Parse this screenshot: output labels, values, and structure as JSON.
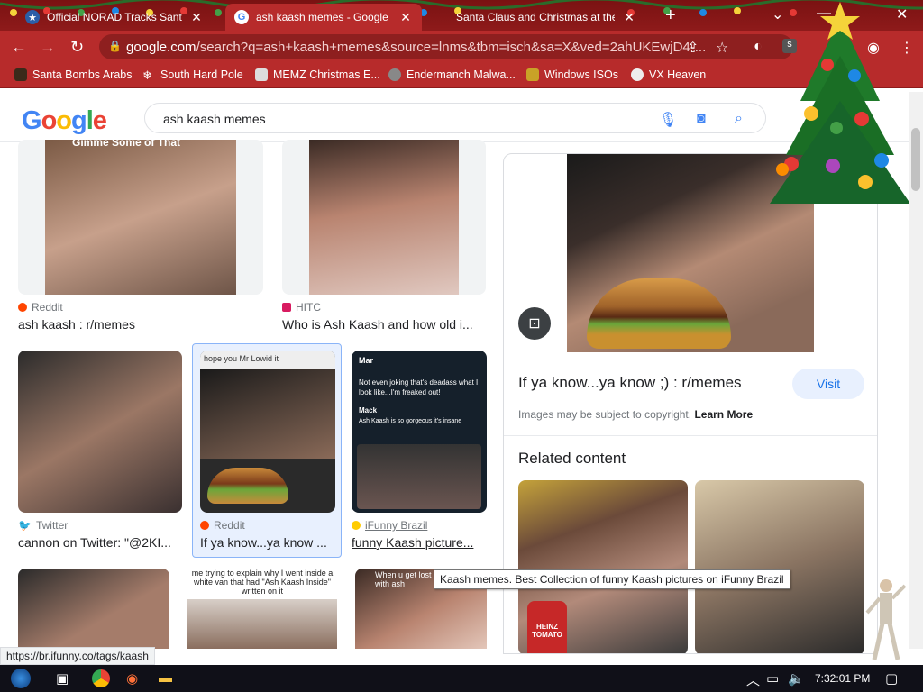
{
  "tabs": [
    {
      "title": "Official NORAD Tracks Santa",
      "active": false
    },
    {
      "title": "ash kaash memes - Google Search",
      "active": true
    },
    {
      "title": "Santa Claus and Christmas at the",
      "active": false
    }
  ],
  "address": {
    "host": "google.com",
    "path": "/search?q=ash+kaash+memes&source=lnms&tbm=isch&sa=X&ved=2ahUKEwjD4-..."
  },
  "bookmarks": [
    "Santa Bombs Arabs",
    "South Hard Pole",
    "MEMZ Christmas E...",
    "Endermanch Malwa...",
    "Windows ISOs",
    "VX Heaven"
  ],
  "google": {
    "logo": "Google",
    "query": "ash kaash memes"
  },
  "results": [
    {
      "source": "Reddit",
      "caption": "ash kaash : r/memes",
      "overlay": "Gimme Some of That"
    },
    {
      "source": "HITC",
      "caption": "Who is Ash Kaash and how old i...",
      "overlay": ""
    },
    {
      "source": "Twitter",
      "caption": "cannon on Twitter: \"@2KI...",
      "overlay": ""
    },
    {
      "source": "Reddit",
      "caption": "If ya know...ya know ...",
      "overlay": "hope you Mr Lowid it"
    },
    {
      "source": "iFunny Brazil",
      "caption": "funny Kaash picture...",
      "overlay": ""
    }
  ],
  "bottom_row_overlays": [
    "me trying to explain why I went inside a white van that had \"Ash Kaash Inside\" written on it",
    "When u get lost in a room with ash"
  ],
  "tweet": {
    "name": "Mar",
    "text": "Not even joking that's deadass what I look like...I'm freaked out!",
    "reply_name": "Mack",
    "reply_text": "Ash Kaash is so gorgeous it's insane"
  },
  "panel": {
    "title": "If ya know...ya know ;) : r/memes",
    "visit": "Visit",
    "copyright": "Images may be subject to copyright.",
    "learn_more": "Learn More",
    "related": "Related content",
    "ketchup": "HEINZ TOMATO"
  },
  "tooltip": "Kaash memes. Best Collection of funny Kaash pictures on iFunny Brazil",
  "status_url": "https://br.ifunny.co/tags/kaash",
  "clock": "7:32:01 PM",
  "colors": {
    "chrome": "#b72b2b",
    "tabbar": "#7a1212",
    "link": "#1a73e8"
  }
}
